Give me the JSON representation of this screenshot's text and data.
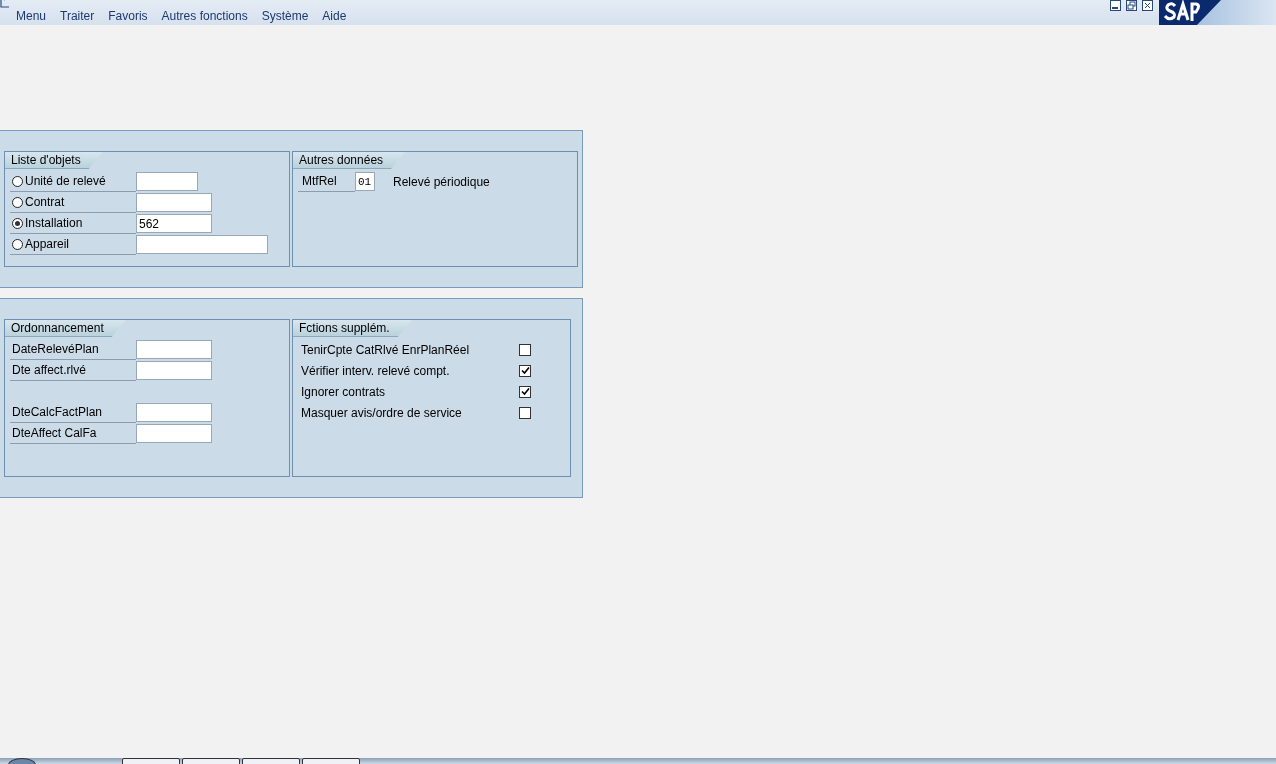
{
  "menu_bar": {
    "items": [
      "Menu",
      "Traiter",
      "Favoris",
      "Autres fonctions",
      "Système",
      "Aide"
    ]
  },
  "groups": [
    {
      "left": {
        "title": "Liste d'objets",
        "rows": [
          {
            "kind": "radio",
            "label": "Unité de relevé",
            "selected": false,
            "value": ""
          },
          {
            "kind": "radio",
            "label": "Contrat",
            "selected": false,
            "value": ""
          },
          {
            "kind": "radio",
            "label": "Installation",
            "selected": true,
            "value": "562"
          },
          {
            "kind": "radio",
            "label": "Appareil",
            "selected": false,
            "value": ""
          }
        ]
      },
      "right": {
        "title": "Autres données",
        "rows": [
          {
            "kind": "code",
            "label": "MtfRel",
            "value": "01",
            "description": "Relevé périodique"
          }
        ]
      }
    },
    {
      "left": {
        "title": "Ordonnancement",
        "rows": [
          {
            "kind": "field",
            "label": "DateRelevéPlan",
            "value": ""
          },
          {
            "kind": "field",
            "label": "Dte affect.rlvé",
            "value": ""
          },
          {
            "kind": "gap"
          },
          {
            "kind": "field",
            "label": "DteCalcFactPlan",
            "value": ""
          },
          {
            "kind": "field",
            "label": "DteAffect CalFa",
            "value": ""
          }
        ]
      },
      "right": {
        "title": "Fctions supplém.",
        "rows": [
          {
            "kind": "check",
            "label": "TenirCpte CatRlvé EnrPlanRéel",
            "checked": false
          },
          {
            "kind": "check",
            "label": "Vérifier interv. relevé compt.",
            "checked": true
          },
          {
            "kind": "check",
            "label": "Ignorer contrats",
            "checked": true
          },
          {
            "kind": "check",
            "label": "Masquer avis/ordre de service",
            "checked": false
          }
        ]
      }
    }
  ]
}
